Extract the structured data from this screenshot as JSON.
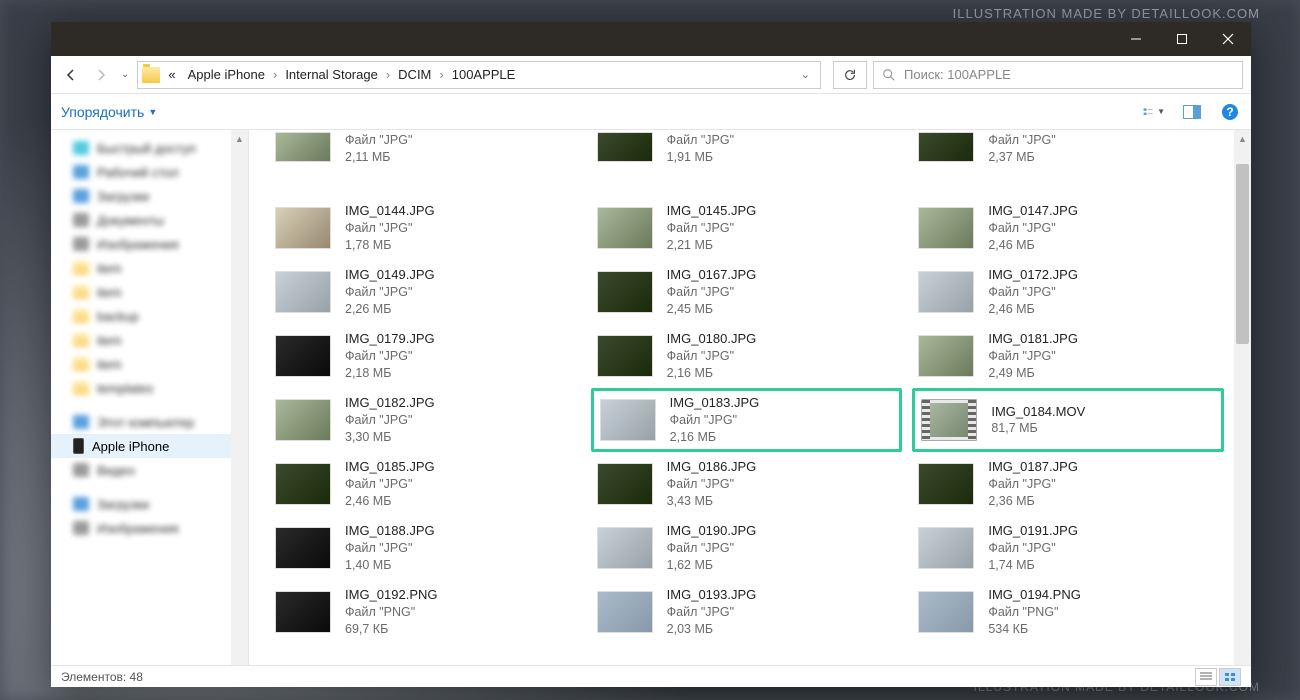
{
  "watermark": "ILLUSTRATION MADE BY DETAILLOOK.COM",
  "watermark2": "ILLUSTRATION MADE BY DETAILLOOK.COM",
  "breadcrumb": {
    "prefix": "«",
    "items": [
      "Apple iPhone",
      "Internal Storage",
      "DCIM",
      "100APPLE"
    ]
  },
  "search": {
    "placeholder": "Поиск: 100APPLE"
  },
  "toolbar": {
    "organize": "Упорядочить"
  },
  "sidebar": {
    "selected": "Apple iPhone"
  },
  "files": [
    {
      "name": "",
      "type": "Файл \"JPG\"",
      "size": "2,11 МБ",
      "th": "t1",
      "top": true
    },
    {
      "name": "",
      "type": "Файл \"JPG\"",
      "size": "1,91 МБ",
      "th": "t3",
      "top": true
    },
    {
      "name": "",
      "type": "Файл \"JPG\"",
      "size": "2,37 МБ",
      "th": "t3",
      "top": true
    },
    {
      "name": "IMG_0144.JPG",
      "type": "Файл \"JPG\"",
      "size": "1,78 МБ",
      "th": "t2"
    },
    {
      "name": "IMG_0145.JPG",
      "type": "Файл \"JPG\"",
      "size": "2,21 МБ",
      "th": "t1"
    },
    {
      "name": "IMG_0147.JPG",
      "type": "Файл \"JPG\"",
      "size": "2,46 МБ",
      "th": "t1"
    },
    {
      "name": "IMG_0149.JPG",
      "type": "Файл \"JPG\"",
      "size": "2,26 МБ",
      "th": "t4"
    },
    {
      "name": "IMG_0167.JPG",
      "type": "Файл \"JPG\"",
      "size": "2,45 МБ",
      "th": "t3"
    },
    {
      "name": "IMG_0172.JPG",
      "type": "Файл \"JPG\"",
      "size": "2,46 МБ",
      "th": "t4"
    },
    {
      "name": "IMG_0179.JPG",
      "type": "Файл \"JPG\"",
      "size": "2,18 МБ",
      "th": "t5"
    },
    {
      "name": "IMG_0180.JPG",
      "type": "Файл \"JPG\"",
      "size": "2,16 МБ",
      "th": "t3"
    },
    {
      "name": "IMG_0181.JPG",
      "type": "Файл \"JPG\"",
      "size": "2,49 МБ",
      "th": "t1"
    },
    {
      "name": "IMG_0182.JPG",
      "type": "Файл \"JPG\"",
      "size": "3,30 МБ",
      "th": "t1"
    },
    {
      "name": "IMG_0183.JPG",
      "type": "Файл \"JPG\"",
      "size": "2,16 МБ",
      "th": "t4",
      "hl": true
    },
    {
      "name": "IMG_0184.MOV",
      "type": "",
      "size": "81,7 МБ",
      "th": "film",
      "hl": true
    },
    {
      "name": "IMG_0185.JPG",
      "type": "Файл \"JPG\"",
      "size": "2,46 МБ",
      "th": "t3"
    },
    {
      "name": "IMG_0186.JPG",
      "type": "Файл \"JPG\"",
      "size": "3,43 МБ",
      "th": "t3"
    },
    {
      "name": "IMG_0187.JPG",
      "type": "Файл \"JPG\"",
      "size": "2,36 МБ",
      "th": "t3"
    },
    {
      "name": "IMG_0188.JPG",
      "type": "Файл \"JPG\"",
      "size": "1,40 МБ",
      "th": "t5"
    },
    {
      "name": "IMG_0190.JPG",
      "type": "Файл \"JPG\"",
      "size": "1,62 МБ",
      "th": "t4"
    },
    {
      "name": "IMG_0191.JPG",
      "type": "Файл \"JPG\"",
      "size": "1,74 МБ",
      "th": "t4"
    },
    {
      "name": "IMG_0192.PNG",
      "type": "Файл \"PNG\"",
      "size": "69,7 КБ",
      "th": "t5"
    },
    {
      "name": "IMG_0193.JPG",
      "type": "Файл \"JPG\"",
      "size": "2,03 МБ",
      "th": "t6"
    },
    {
      "name": "IMG_0194.PNG",
      "type": "Файл \"PNG\"",
      "size": "534 КБ",
      "th": "t6"
    }
  ],
  "status": {
    "count_label": "Элементов:",
    "count": "48"
  }
}
